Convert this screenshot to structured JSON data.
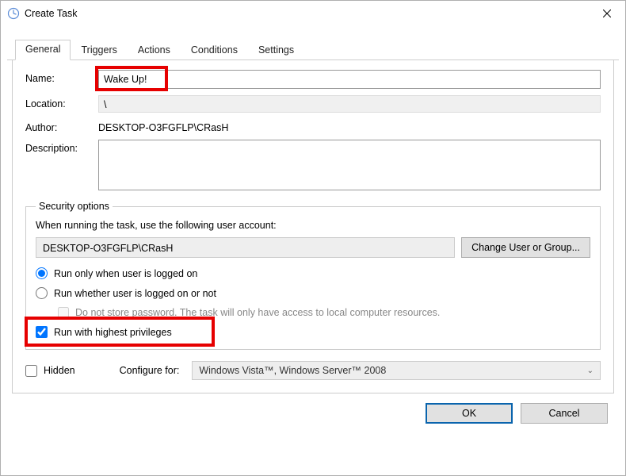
{
  "window": {
    "title": "Create Task"
  },
  "tabs": {
    "general": "General",
    "triggers": "Triggers",
    "actions": "Actions",
    "conditions": "Conditions",
    "settings": "Settings"
  },
  "general": {
    "name_label": "Name:",
    "name_value": "Wake Up!",
    "location_label": "Location:",
    "location_value": "\\",
    "author_label": "Author:",
    "author_value": "DESKTOP-O3FGFLP\\CRasH",
    "description_label": "Description:",
    "description_value": ""
  },
  "security": {
    "legend": "Security options",
    "prompt": "When running the task, use the following user account:",
    "account": "DESKTOP-O3FGFLP\\CRasH",
    "change_button": "Change User or Group...",
    "radio_logged_on": "Run only when user is logged on",
    "radio_whether": "Run whether user is logged on or not",
    "dont_store_label": "Do not store password.  The task will only have access to local computer resources.",
    "highest_priv": "Run with highest privileges"
  },
  "bottom": {
    "hidden_label": "Hidden",
    "configure_label": "Configure for:",
    "configure_value": "Windows Vista™, Windows Server™ 2008"
  },
  "buttons": {
    "ok": "OK",
    "cancel": "Cancel"
  }
}
